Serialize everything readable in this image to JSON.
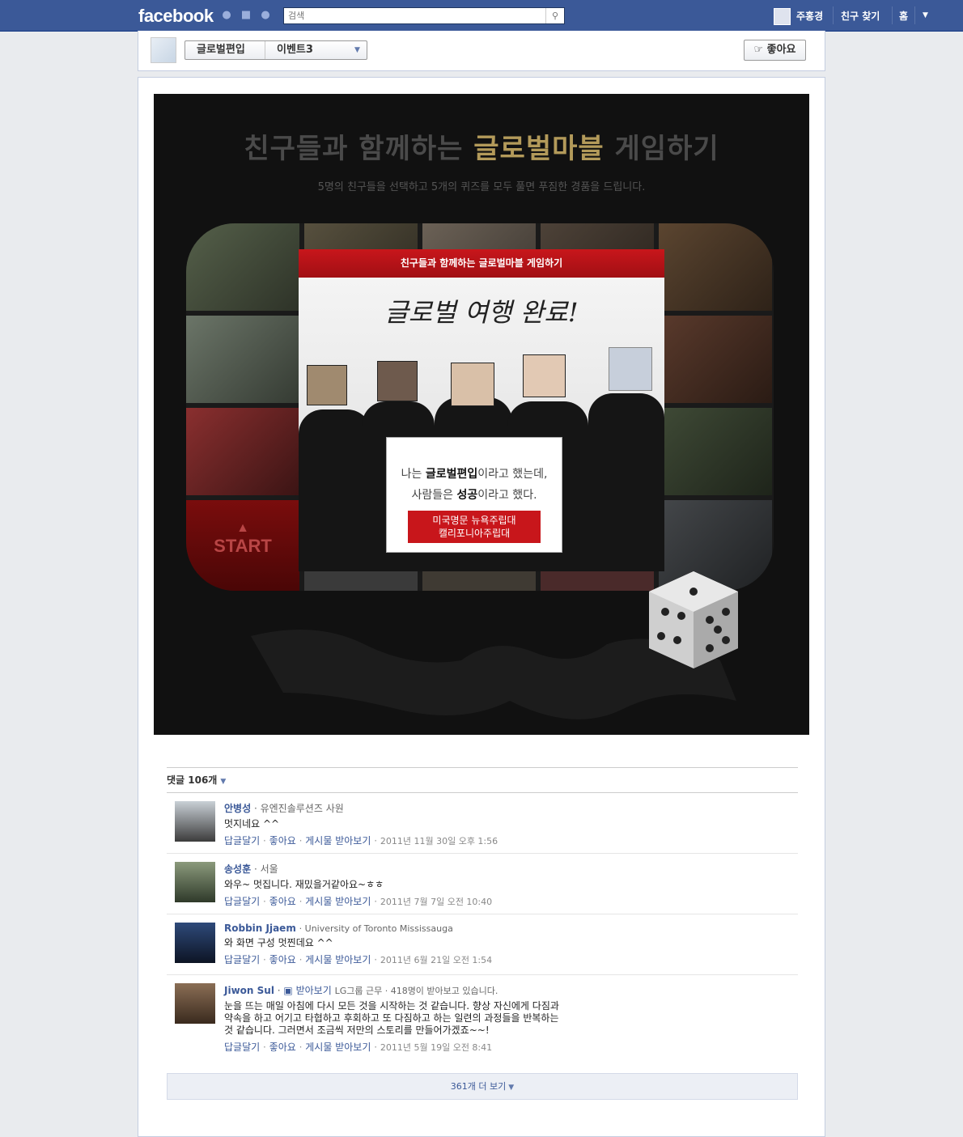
{
  "topbar": {
    "logo": "facebook",
    "search_placeholder": "검색",
    "user_name": "주홍경",
    "find_friends": "친구 찾기",
    "home": "홈"
  },
  "subhead": {
    "breadcrumb_page": "글로벌편입",
    "breadcrumb_tab": "이벤트3",
    "like_label": "좋아요"
  },
  "game": {
    "title_prefix": "친구들과 함께하는 ",
    "title_highlight": "글로벌마블",
    "title_suffix": " 게임하기",
    "subtitle": "5명의 친구들을 선택하고 5개의 퀴즈를 모두 풀면 푸짐한 경품을 드립니다.",
    "start_label": "START",
    "popup": {
      "header": "친구들과 함께하는 글로벌마블 게임하기",
      "complete_text": "글로벌 여행 완료!",
      "sign_line1_pre": "나는 ",
      "sign_line1_bold": "글로벌편입",
      "sign_line1_post": "이라고 했는데,",
      "sign_line2_pre": "사람들은 ",
      "sign_line2_bold": "성공",
      "sign_line2_post": "이라고 했다.",
      "badge_line1": "미국명문 뉴욕주립대",
      "badge_line2": "캘리포니아주립대"
    }
  },
  "comments": {
    "header": "댓글 106개",
    "items": [
      {
        "name": "안병성",
        "meta": "유엔진솔루션즈 사원",
        "text": "멋지네요 ^^",
        "reply": "답글달기",
        "like": "좋아요",
        "subscribe": "게시물 받아보기",
        "time": "2011년 11월 30일 오후 1:56"
      },
      {
        "name": "송성훈",
        "meta": "서울",
        "text": "와우~ 멋집니다. 재밌을거같아요~ㅎㅎ",
        "reply": "답글달기",
        "like": "좋아요",
        "subscribe": "게시물 받아보기",
        "time": "2011년 7월 7일 오전 10:40"
      },
      {
        "name": "Robbin Jjaem",
        "meta": "University of Toronto Mississauga",
        "text": "와 화면 구성 멋찐데요 ^^",
        "reply": "답글달기",
        "like": "좋아요",
        "subscribe": "게시물 받아보기",
        "time": "2011년 6월 21일 오전 1:54"
      },
      {
        "name": "Jiwon Sul",
        "follow": "받아보기",
        "meta": "LG그룹 근무 · 418명이 받아보고 있습니다.",
        "text": "눈을 뜨는 매일 아침에 다시 모든 것을 시작하는 것 같습니다. 향상 자신에게 다짐과 약속을 하고 어기고 타협하고 후회하고 또 다짐하고 하는 일련의 과정들을 반복하는 것 같습니다. 그러면서 조금씩 저만의 스토리를 만들어가겠죠~~!",
        "reply": "답글달기",
        "like": "좋아요",
        "subscribe": "게시물 받아보기",
        "time": "2011년 5월 19일 오전 8:41"
      }
    ],
    "more": "361개 더 보기"
  },
  "colors": {
    "fb_blue": "#3b5998",
    "link": "#3b5998",
    "accent_red": "#c8161b",
    "gold": "#b39a5a"
  }
}
